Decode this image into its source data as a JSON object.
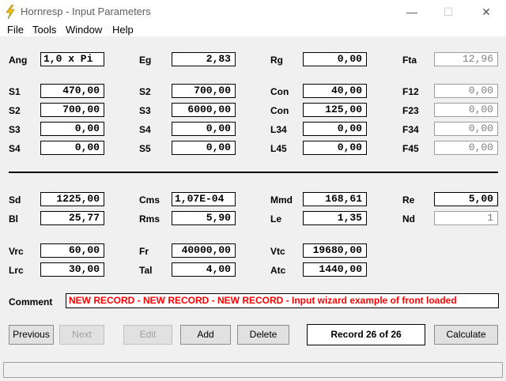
{
  "window": {
    "title": "Hornresp - Input Parameters",
    "min": "—",
    "max": "☐",
    "close": "✕"
  },
  "menu": [
    "File",
    "Tools",
    "Window",
    "Help"
  ],
  "fields": {
    "Ang": "1,0 x Pi",
    "Eg": "2,83",
    "Rg": "0,00",
    "Fta": "12,96",
    "S1": "470,00",
    "S2a": "700,00",
    "Con1": "40,00",
    "F12": "0,00",
    "S2b": "700,00",
    "S3a": "6000,00",
    "Con2": "125,00",
    "F23": "0,00",
    "S3b": "0,00",
    "S4a": "0,00",
    "L34": "0,00",
    "F34": "0,00",
    "S4b": "0,00",
    "S5": "0,00",
    "L45": "0,00",
    "F45": "0,00",
    "Sd": "1225,00",
    "Cms": "1,07E-04",
    "Mmd": "168,61",
    "Re": "5,00",
    "Bl": "25,77",
    "Rms": "5,90",
    "Le": "1,35",
    "Nd": "1",
    "Vrc": "60,00",
    "Fr": "40000,00",
    "Vtc": "19680,00",
    "Lrc": "30,00",
    "Tal": "4,00",
    "Atc": "1440,00"
  },
  "labels": {
    "Ang": "Ang",
    "Eg": "Eg",
    "Rg": "Rg",
    "Fta": "Fta",
    "S1": "S1",
    "S2": "S2",
    "Con": "Con",
    "F12": "F12",
    "S3": "S3",
    "F23": "F23",
    "S4": "S4",
    "L34": "L34",
    "F34": "F34",
    "S5": "S5",
    "L45": "L45",
    "F45": "F45",
    "Sd": "Sd",
    "Cms": "Cms",
    "Mmd": "Mmd",
    "Re": "Re",
    "Bl": "Bl",
    "Rms": "Rms",
    "Le": "Le",
    "Nd": "Nd",
    "Vrc": "Vrc",
    "Fr": "Fr",
    "Vtc": "Vtc",
    "Lrc": "Lrc",
    "Tal": "Tal",
    "Atc": "Atc"
  },
  "comment": {
    "label": "Comment",
    "value": "NEW RECORD - NEW RECORD - NEW RECORD - Input wizard example of front loaded"
  },
  "buttons": {
    "previous": "Previous",
    "next": "Next",
    "edit": "Edit",
    "add": "Add",
    "delete": "Delete",
    "record": "Record 26 of 26",
    "calculate": "Calculate"
  },
  "colors": {
    "comment_text": "#ff0000",
    "field_border": "#000000",
    "accent_icon": "#f5c400"
  }
}
